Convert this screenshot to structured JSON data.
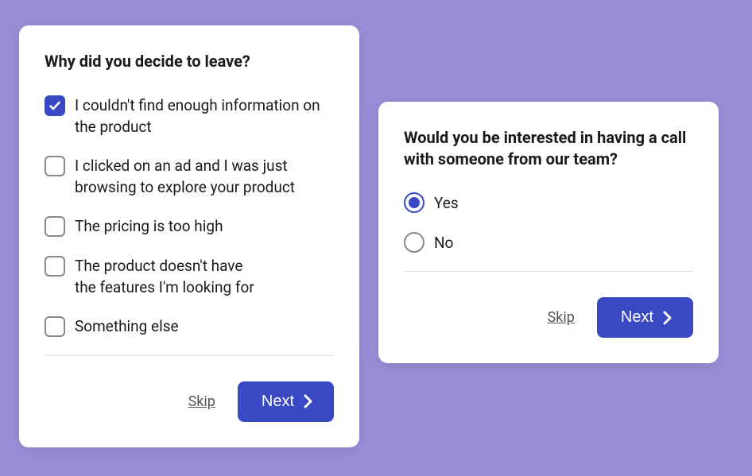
{
  "card1": {
    "question": "Why did you decide to leave?",
    "options": [
      {
        "label": "I couldn't find enough information on the product",
        "checked": true
      },
      {
        "label": "I clicked on an ad and I was just browsing to explore your product",
        "checked": false
      },
      {
        "label": "The pricing is too high",
        "checked": false
      },
      {
        "label": "The product doesn't have the features I'm looking for",
        "checked": false
      },
      {
        "label": "Something else",
        "checked": false
      }
    ],
    "skip": "Skip",
    "next": "Next"
  },
  "card2": {
    "question": "Would you be interested in having a call with someone from our team?",
    "options": [
      {
        "label": "Yes",
        "selected": true
      },
      {
        "label": "No",
        "selected": false
      }
    ],
    "skip": "Skip",
    "next": "Next"
  }
}
